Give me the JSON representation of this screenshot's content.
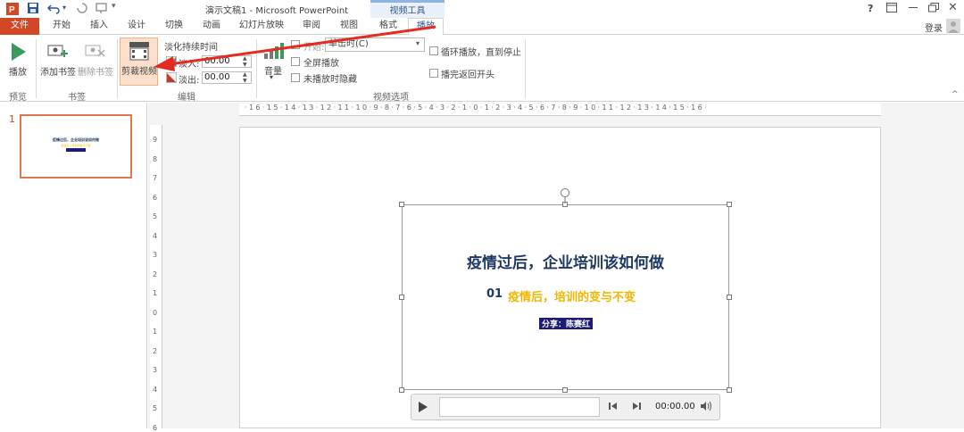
{
  "window": {
    "title": "演示文稿1 - Microsoft PowerPoint",
    "context_tab_group": "视频工具",
    "controls": {
      "help": "?",
      "signin": "登录"
    }
  },
  "tabs": [
    "文件",
    "开始",
    "插入",
    "设计",
    "切换",
    "动画",
    "幻灯片放映",
    "审阅",
    "视图",
    "格式",
    "播放"
  ],
  "ribbon": {
    "preview": {
      "play_label": "播放",
      "group_label": "预览"
    },
    "bookmarks": {
      "add_label": "添加书签",
      "remove_label": "删除书签",
      "group_label": "书签"
    },
    "editing": {
      "trim_label": "剪裁视频",
      "fade_title": "淡化持续时间",
      "fade_in_label": "淡入:",
      "fade_in_value": "00.00",
      "fade_out_label": "淡出:",
      "fade_out_value": "00.00",
      "group_label": "编辑"
    },
    "video_options": {
      "volume_label": "音量",
      "start_label": "开始:",
      "start_value": "单击时(C)",
      "fullscreen_label": "全屏播放",
      "hide_label": "未播放时隐藏",
      "loop_label": "循环播放，直到停止",
      "rewind_label": "播完返回开头",
      "group_label": "视频选项"
    }
  },
  "slides_pane": {
    "slide_number": "1"
  },
  "ruler": {
    "horizontal": "·16·15·14·13·12·11·10·9·8·7·6·5·4·3·2·1·0·1·2·3·4·5·6·7·8·9·10·11·12·13·14·15·16·"
  },
  "slide": {
    "title": "疫情过后，企业培训该如何做",
    "subtitle_number": "01",
    "subtitle_text": "疫情后，培训的变与不变",
    "presenter": "分享：陈赛红"
  },
  "player": {
    "time": "00:00.00"
  },
  "colors": {
    "file_tab": "#d24726",
    "accent": "#2f5597",
    "title_text": "#1f3864",
    "subtitle_text": "#f2b600",
    "presenter_bg": "#1c1c74",
    "annotation_arrow": "#e32b1f"
  }
}
